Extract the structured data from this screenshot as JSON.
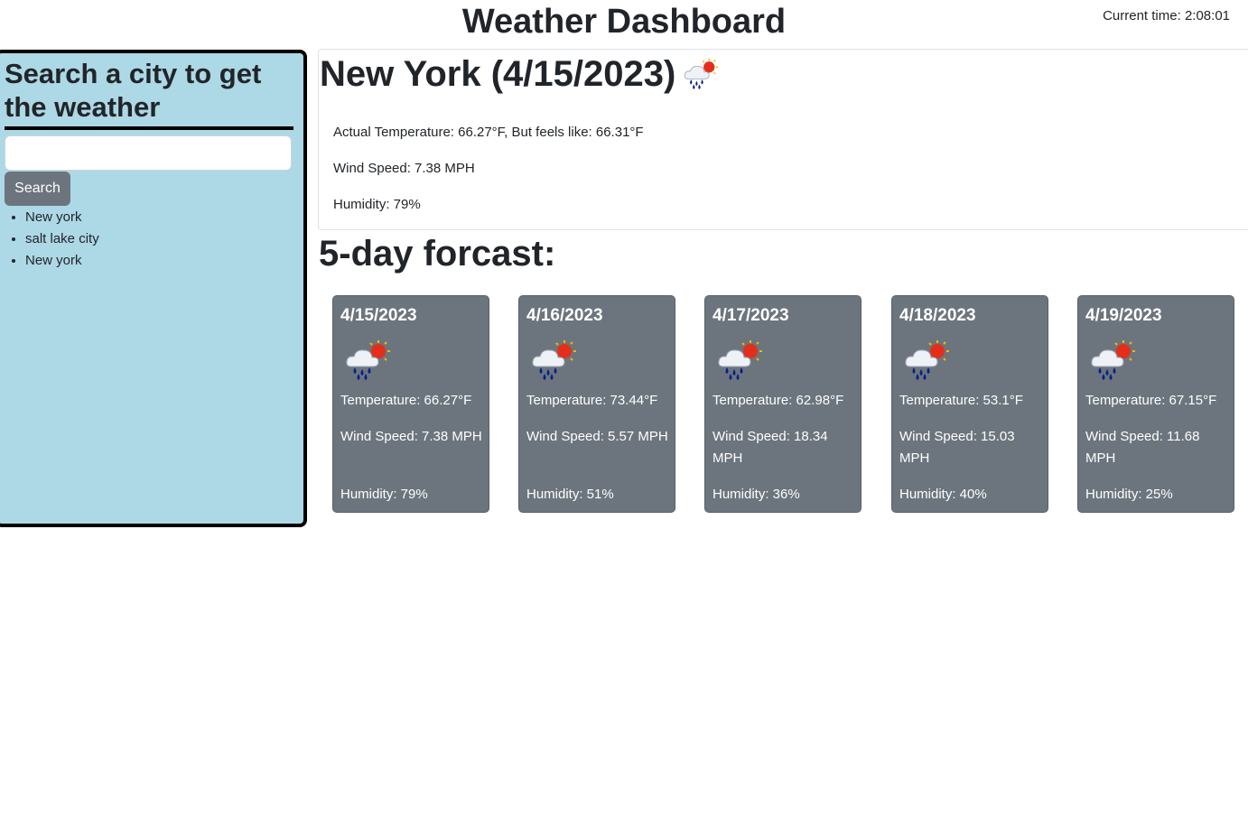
{
  "header": {
    "title": "Weather Dashboard",
    "clock_label": "Current time:",
    "clock_time": "2:08:01"
  },
  "sidebar": {
    "heading": "Search a city to get the weather",
    "search_value": "",
    "search_button_label": "Search",
    "history": [
      "New york",
      "salt lake city",
      "New york"
    ]
  },
  "current": {
    "title": "New York (4/15/2023)",
    "icon": "rain-sun-icon",
    "temperature": "Actual Temperature: 66.27°F, But feels like: 66.31°F",
    "wind": "Wind Speed: 7.38 MPH",
    "humidity": "Humidity: 79%"
  },
  "forecast": {
    "heading": "5-day forcast:",
    "days": [
      {
        "date": "4/15/2023",
        "icon": "rain-sun-icon",
        "temperature": "Temperature: 66.27°F",
        "wind": "Wind Speed: 7.38 MPH",
        "humidity": "Humidity: 79%"
      },
      {
        "date": "4/16/2023",
        "icon": "rain-sun-icon",
        "temperature": "Temperature: 73.44°F",
        "wind": "Wind Speed: 5.57 MPH",
        "humidity": "Humidity: 51%"
      },
      {
        "date": "4/17/2023",
        "icon": "rain-sun-icon",
        "temperature": "Temperature: 62.98°F",
        "wind": "Wind Speed: 18.34 MPH",
        "humidity": "Humidity: 36%"
      },
      {
        "date": "4/18/2023",
        "icon": "rain-sun-icon",
        "temperature": "Temperature: 53.1°F",
        "wind": "Wind Speed: 15.03 MPH",
        "humidity": "Humidity: 40%"
      },
      {
        "date": "4/19/2023",
        "icon": "rain-sun-icon",
        "temperature": "Temperature: 67.15°F",
        "wind": "Wind Speed: 11.68 MPH",
        "humidity": "Humidity: 25%"
      }
    ]
  },
  "colors": {
    "sidebar_bg": "#add8e6",
    "card_bg": "#6c757d",
    "button_bg": "#6c757d"
  }
}
